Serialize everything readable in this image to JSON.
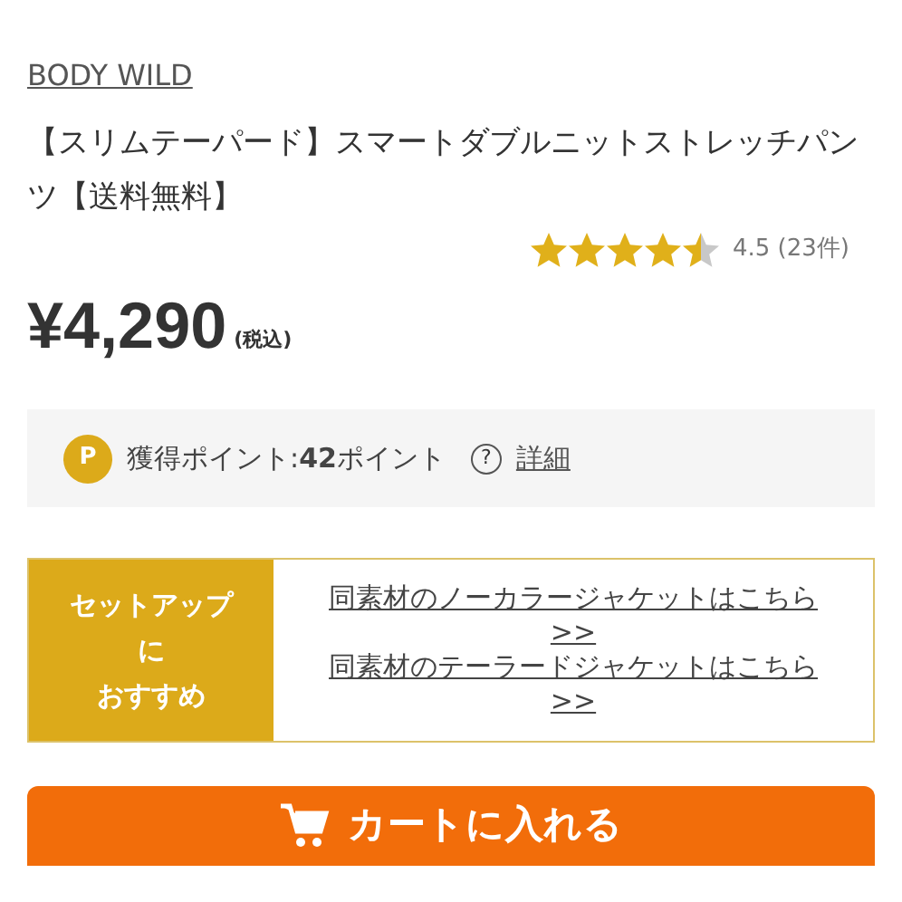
{
  "brand": "BODY WILD",
  "product_title": "【スリムテーパード】スマートダブルニットストレッチパンツ【送料無料】",
  "rating": {
    "stars": 4.5,
    "text": "4.5 (23件)"
  },
  "price": {
    "amount": "¥4,290",
    "tax_note": "(税込)"
  },
  "points": {
    "badge": "P",
    "text": "獲得ポイント:**42**ポイント",
    "help": "?",
    "details_link": "詳細"
  },
  "setup": {
    "label_lines": [
      "セットアップ",
      "に",
      "おすすめ"
    ],
    "links": [
      "同素材のノーカラージャケットはこちら >>",
      "同素材のテーラードジャケットはこちら >>"
    ]
  },
  "cart_button": "カートに入れる"
}
